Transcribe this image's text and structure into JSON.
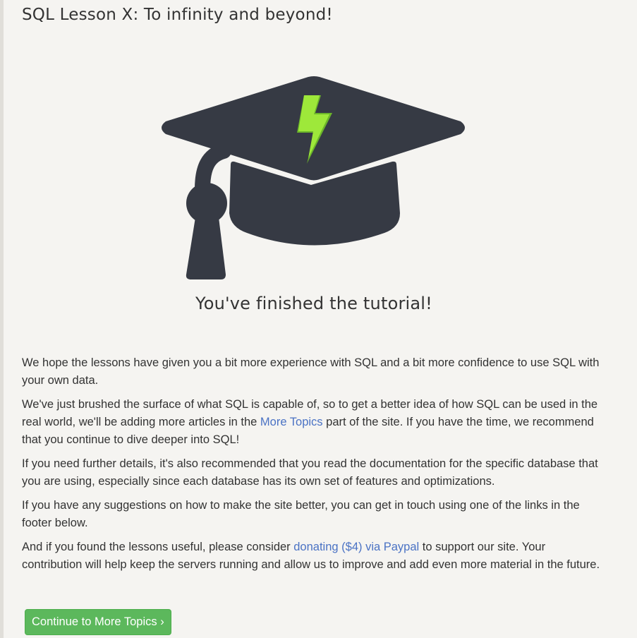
{
  "header": {
    "title": "SQL Lesson X: To infinity and beyond!"
  },
  "hero": {
    "icon": "graduation-cap-icon",
    "bolt_icon": "lightning-bolt-icon",
    "message": "You've finished the tutorial!",
    "colors": {
      "cap": "#363a44",
      "bolt_light": "#9ee83a",
      "bolt_dark": "#6bb52a"
    }
  },
  "content": {
    "p1": "We hope the lessons have given you a bit more experience with SQL and a bit more confidence to use SQL with your own data.",
    "p2_before": "We've just brushed the surface of what SQL is capable of, so to get a better idea of how SQL can be used in the real world, we'll be adding more articles in the ",
    "p2_link": "More Topics",
    "p2_after": " part of the site. If you have the time, we recommend that you continue to dive deeper into SQL!",
    "p3": "If you need further details, it's also recommended that you read the documentation for the specific database that you are using, especially since each database has its own set of features and optimizations.",
    "p4": "If you have any suggestions on how to make the site better, you can get in touch using one of the links in the footer below.",
    "p5_before": "And if you found the lessons useful, please consider ",
    "p5_link": "donating ($4) via Paypal",
    "p5_after": " to support our site. Your contribution will help keep the servers running and allow us to improve and add even more material in the future."
  },
  "actions": {
    "continue_label": "Continue to More Topics ›",
    "colors": {
      "button": "#5cb85c",
      "link": "#4a72c4"
    }
  }
}
